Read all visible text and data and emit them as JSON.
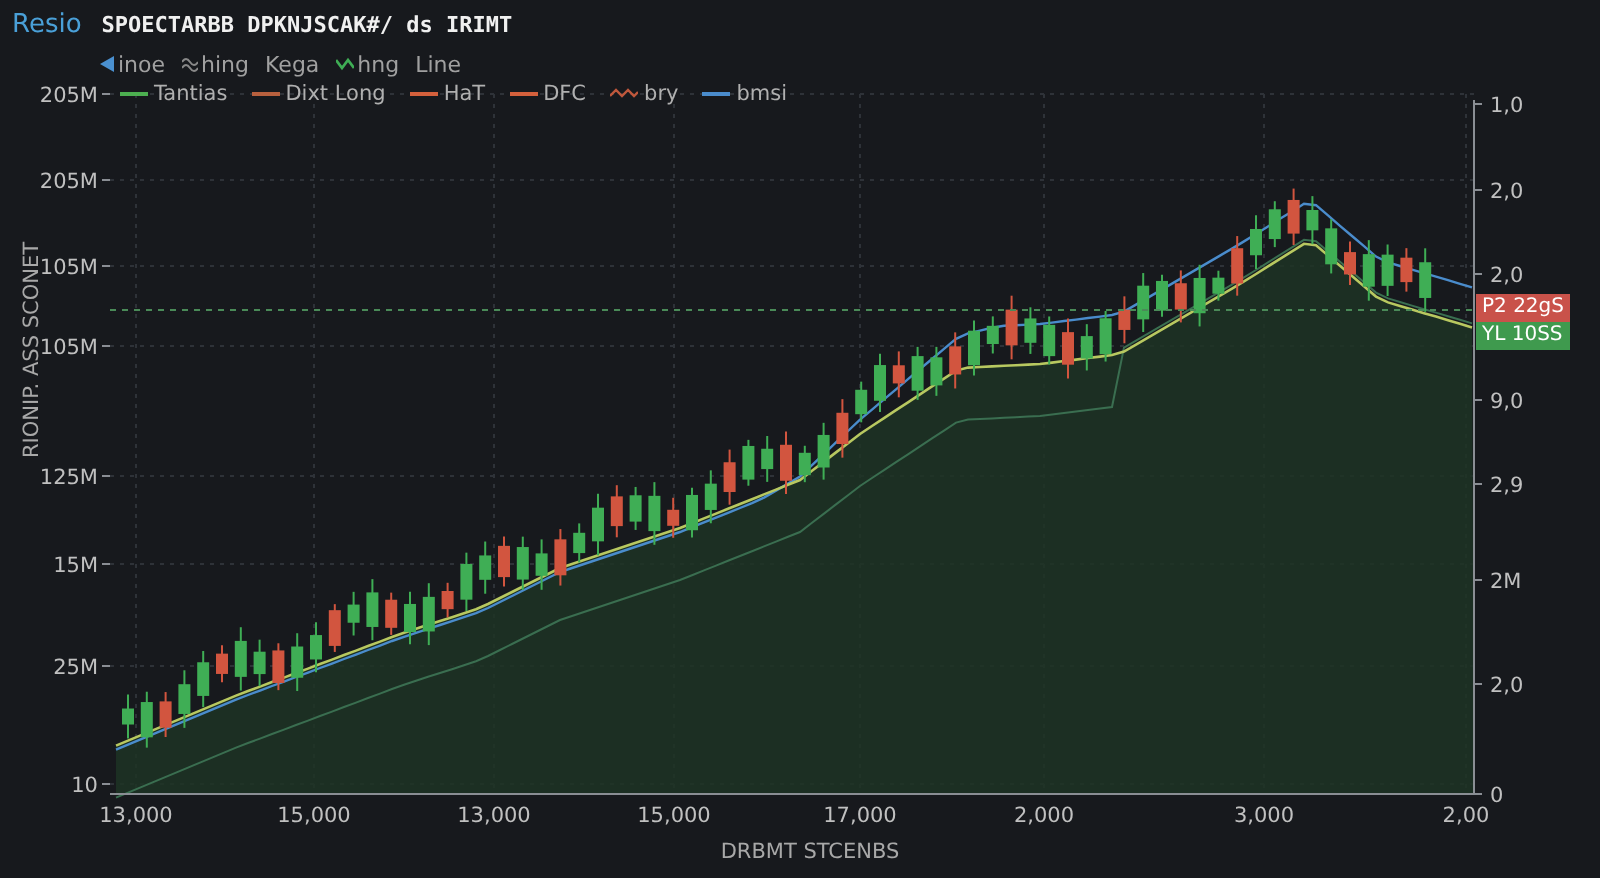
{
  "header": {
    "app_name": "Resio",
    "title": "SPOECTARBB DPKNJSCAK#/ ds IRIMT"
  },
  "toolbar": [
    {
      "label": "inoe",
      "kind": "arrow"
    },
    {
      "label": "hing",
      "kind": "wave"
    },
    {
      "label": "Kega",
      "kind": "none"
    },
    {
      "label": "hng",
      "kind": "zigzag"
    },
    {
      "label": "Line",
      "kind": "none"
    }
  ],
  "chart": {
    "legend": [
      {
        "label": "Tantias",
        "kind": "line",
        "color": "#4caf50"
      },
      {
        "label": "Dixt Long",
        "kind": "line",
        "color": "#b8603e"
      },
      {
        "label": "HaT",
        "kind": "line",
        "color": "#d4603c"
      },
      {
        "label": "DFC",
        "kind": "line",
        "color": "#d4603c"
      },
      {
        "label": "bry",
        "kind": "wave",
        "color": "#c0583c"
      },
      {
        "label": "bmsi",
        "kind": "line",
        "color": "#4a8ccc"
      }
    ],
    "y_axis_title": "RIONIP. ASS SCONET",
    "x_axis_title": "DRBMT STCENBS",
    "left_ticks": [
      "205M",
      "205M",
      "105M",
      "105M",
      "125M",
      "15M",
      "25M",
      "10"
    ],
    "right_ticks": [
      "1,0",
      "2,0",
      "2,0",
      "9,0",
      "2,9",
      "2M",
      "2,0",
      "0"
    ],
    "x_ticks": [
      "13,000",
      "15,000",
      "13,000",
      "15,000",
      "17,000",
      "2,000",
      "3,000",
      "2,00"
    ],
    "price_labels": [
      {
        "text": "P2 22gS",
        "color": "#c9524a"
      },
      {
        "text": "YL 10SS",
        "color": "#3f9a4e"
      }
    ]
  }
}
